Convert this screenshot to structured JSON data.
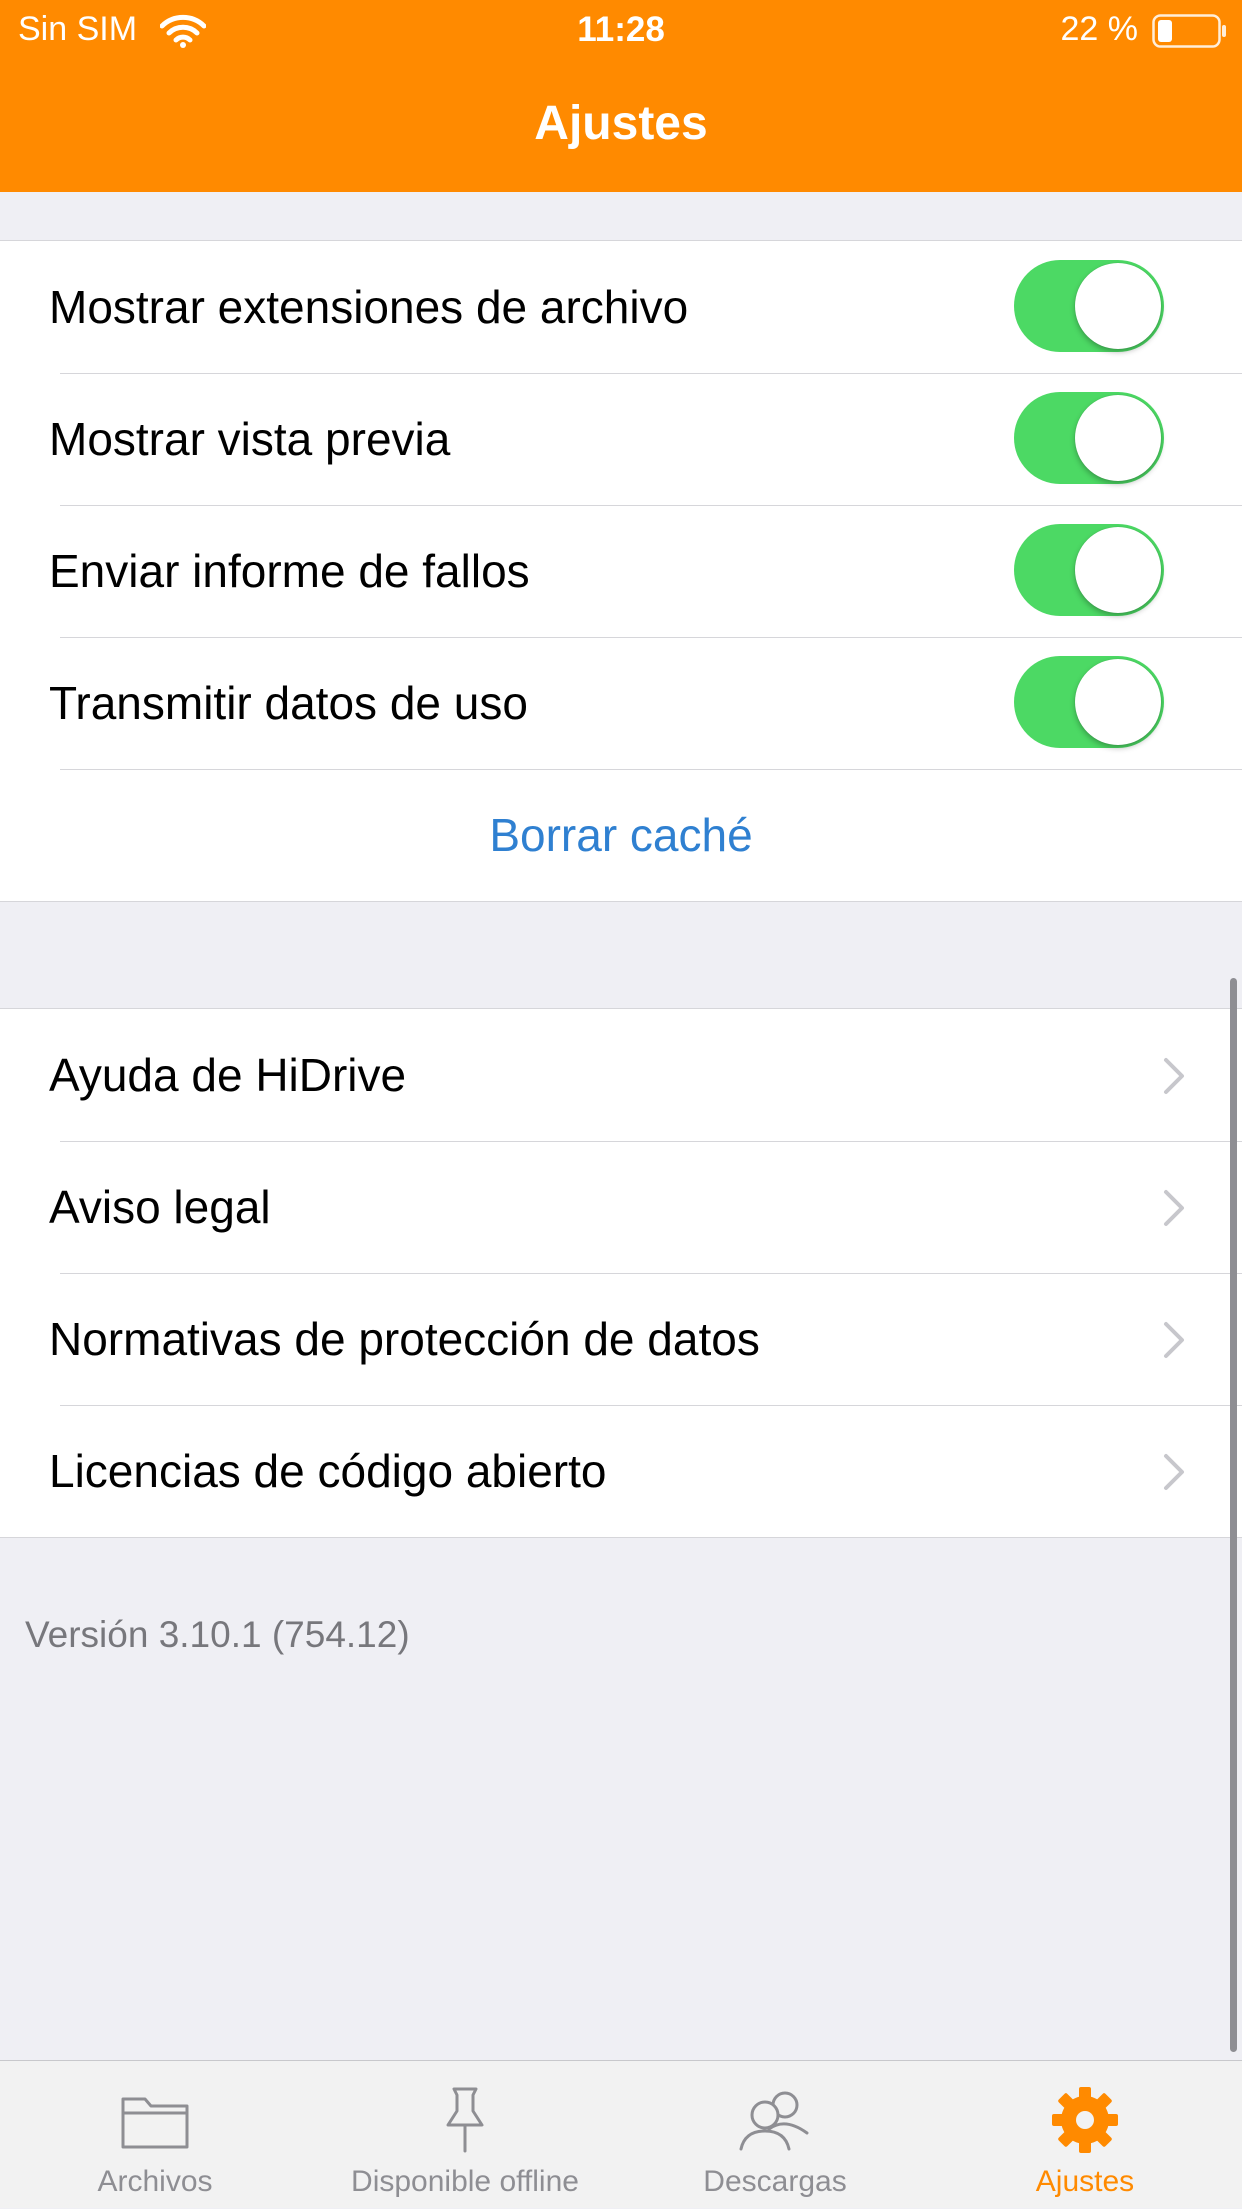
{
  "status_bar": {
    "carrier": "Sin SIM",
    "time": "11:28",
    "battery": "22 %"
  },
  "nav": {
    "title": "Ajustes"
  },
  "colors": {
    "accent": "#ff8a00",
    "toggle_on": "#4cd964",
    "link": "#2f80d1"
  },
  "settings": {
    "toggles": [
      {
        "label": "Mostrar extensiones de archivo",
        "on": true
      },
      {
        "label": "Mostrar vista previa",
        "on": true
      },
      {
        "label": "Enviar informe de fallos",
        "on": true
      },
      {
        "label": "Transmitir datos de uso",
        "on": true
      }
    ],
    "clear_cache": "Borrar caché"
  },
  "links": [
    {
      "label": "Ayuda de HiDrive",
      "icon": "chevron-right-icon"
    },
    {
      "label": "Aviso legal",
      "icon": "chevron-right-icon"
    },
    {
      "label": "Normativas de protección de datos",
      "icon": "chevron-right-icon"
    },
    {
      "label": "Licencias de código abierto",
      "icon": "chevron-right-icon"
    }
  ],
  "version": "Versión 3.10.1 (754.12)",
  "tabs": [
    {
      "label": "Archivos",
      "icon": "folder-icon",
      "active": false
    },
    {
      "label": "Disponible offline",
      "icon": "pin-icon",
      "active": false
    },
    {
      "label": "Descargas",
      "icon": "users-icon",
      "active": false
    },
    {
      "label": "Ajustes",
      "icon": "gear-icon",
      "active": true
    }
  ]
}
